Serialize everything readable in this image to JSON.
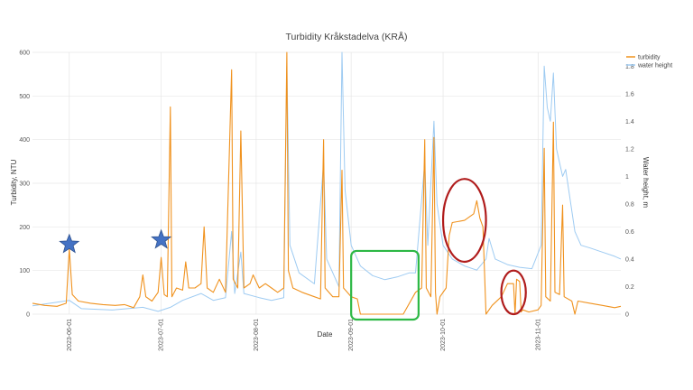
{
  "chart_data": {
    "type": "line",
    "title": "Turbidity Kråkstadelva (KRÅ)",
    "xlabel": "Date",
    "ylabel_left": "Turbidity, NTU",
    "ylabel_right": "Water height, m",
    "ylim_left": [
      0,
      600
    ],
    "ylim_right": [
      0,
      1.9
    ],
    "yticks_left": [
      "0",
      "100",
      "200",
      "300",
      "400",
      "500",
      "600"
    ],
    "yticks_right": [
      "0",
      "0.2",
      "0.4",
      "0.6",
      "0.8",
      "1",
      "1.2",
      "1.4",
      "1.6",
      "1.8"
    ],
    "x_range": [
      "2023-05-20",
      "2023-11-28"
    ],
    "xticks": [
      "2023-06-01",
      "2023-07-01",
      "2023-08-01",
      "2023-09-01",
      "2023-10-01",
      "2023-11-01"
    ],
    "grid": true,
    "legend_position": "top-right",
    "colors": {
      "turbidity": "#f0921e",
      "water_height": "#9ecbf2",
      "star": "#4472c4",
      "green_box": "#2db845",
      "red_ellipse": "#b01c1c"
    },
    "series": [
      {
        "name": "turbidity",
        "axis": "left",
        "points": [
          [
            "2023-05-20",
            25
          ],
          [
            "2023-05-24",
            20
          ],
          [
            "2023-05-28",
            18
          ],
          [
            "2023-05-31",
            25
          ],
          [
            "2023-06-01",
            150
          ],
          [
            "2023-06-02",
            45
          ],
          [
            "2023-06-04",
            30
          ],
          [
            "2023-06-08",
            25
          ],
          [
            "2023-06-12",
            22
          ],
          [
            "2023-06-16",
            20
          ],
          [
            "2023-06-19",
            22
          ],
          [
            "2023-06-22",
            15
          ],
          [
            "2023-06-24",
            40
          ],
          [
            "2023-06-25",
            90
          ],
          [
            "2023-06-26",
            40
          ],
          [
            "2023-06-28",
            30
          ],
          [
            "2023-06-30",
            50
          ],
          [
            "2023-07-01",
            130
          ],
          [
            "2023-07-02",
            45
          ],
          [
            "2023-07-03",
            40
          ],
          [
            "2023-07-04",
            475
          ],
          [
            "2023-07-04T12",
            40
          ],
          [
            "2023-07-06",
            60
          ],
          [
            "2023-07-08",
            55
          ],
          [
            "2023-07-09",
            120
          ],
          [
            "2023-07-10",
            60
          ],
          [
            "2023-07-12",
            60
          ],
          [
            "2023-07-14",
            70
          ],
          [
            "2023-07-15",
            200
          ],
          [
            "2023-07-16",
            60
          ],
          [
            "2023-07-18",
            50
          ],
          [
            "2023-07-20",
            80
          ],
          [
            "2023-07-22",
            50
          ],
          [
            "2023-07-24",
            560
          ],
          [
            "2023-07-24T12",
            80
          ],
          [
            "2023-07-26",
            60
          ],
          [
            "2023-07-27",
            420
          ],
          [
            "2023-07-28",
            60
          ],
          [
            "2023-07-30",
            70
          ],
          [
            "2023-07-31",
            90
          ],
          [
            "2023-08-02",
            60
          ],
          [
            "2023-08-04",
            70
          ],
          [
            "2023-08-06",
            60
          ],
          [
            "2023-08-08",
            50
          ],
          [
            "2023-08-10",
            60
          ],
          [
            "2023-08-11",
            600
          ],
          [
            "2023-08-11T12",
            100
          ],
          [
            "2023-08-13",
            60
          ],
          [
            "2023-08-16",
            50
          ],
          [
            "2023-08-20",
            40
          ],
          [
            "2023-08-22",
            35
          ],
          [
            "2023-08-23",
            400
          ],
          [
            "2023-08-23T12",
            60
          ],
          [
            "2023-08-26",
            40
          ],
          [
            "2023-08-28",
            40
          ],
          [
            "2023-08-29",
            330
          ],
          [
            "2023-08-29T12",
            60
          ],
          [
            "2023-09-01",
            40
          ],
          [
            "2023-09-03",
            35
          ],
          [
            "2023-09-04",
            0
          ],
          [
            "2023-09-18",
            0
          ],
          [
            "2023-09-22",
            50
          ],
          [
            "2023-09-24",
            60
          ],
          [
            "2023-09-25",
            400
          ],
          [
            "2023-09-25T12",
            60
          ],
          [
            "2023-09-27",
            40
          ],
          [
            "2023-09-28",
            405
          ],
          [
            "2023-09-28T12",
            50
          ],
          [
            "2023-09-29",
            0
          ],
          [
            "2023-09-30",
            40
          ],
          [
            "2023-10-02",
            60
          ],
          [
            "2023-10-03",
            180
          ],
          [
            "2023-10-04",
            210
          ],
          [
            "2023-10-08",
            215
          ],
          [
            "2023-10-11",
            230
          ],
          [
            "2023-10-12",
            260
          ],
          [
            "2023-10-13",
            220
          ],
          [
            "2023-10-14",
            200
          ],
          [
            "2023-10-15",
            0
          ],
          [
            "2023-10-17",
            20
          ],
          [
            "2023-10-20",
            40
          ],
          [
            "2023-10-22",
            70
          ],
          [
            "2023-10-24",
            70
          ],
          [
            "2023-10-24T12",
            0
          ],
          [
            "2023-10-25",
            80
          ],
          [
            "2023-10-26",
            75
          ],
          [
            "2023-10-26T12",
            5
          ],
          [
            "2023-10-27",
            10
          ],
          [
            "2023-10-29",
            5
          ],
          [
            "2023-11-01",
            10
          ],
          [
            "2023-11-02",
            20
          ],
          [
            "2023-11-03",
            380
          ],
          [
            "2023-11-03T12",
            40
          ],
          [
            "2023-11-05",
            30
          ],
          [
            "2023-11-06",
            440
          ],
          [
            "2023-11-06T12",
            50
          ],
          [
            "2023-11-08",
            45
          ],
          [
            "2023-11-09",
            250
          ],
          [
            "2023-11-09T12",
            40
          ],
          [
            "2023-11-12",
            30
          ],
          [
            "2023-11-13",
            0
          ],
          [
            "2023-11-14",
            30
          ],
          [
            "2023-11-18",
            25
          ],
          [
            "2023-11-22",
            20
          ],
          [
            "2023-11-26",
            15
          ],
          [
            "2023-11-28",
            18
          ]
        ]
      },
      {
        "name": "water height",
        "axis": "right",
        "points": [
          [
            "2023-05-20",
            0.06
          ],
          [
            "2023-06-01",
            0.1
          ],
          [
            "2023-06-05",
            0.04
          ],
          [
            "2023-06-15",
            0.03
          ],
          [
            "2023-06-25",
            0.05
          ],
          [
            "2023-06-30",
            0.02
          ],
          [
            "2023-07-04",
            0.05
          ],
          [
            "2023-07-08",
            0.1
          ],
          [
            "2023-07-14",
            0.15
          ],
          [
            "2023-07-18",
            0.1
          ],
          [
            "2023-07-22",
            0.12
          ],
          [
            "2023-07-24",
            0.6
          ],
          [
            "2023-07-25",
            0.15
          ],
          [
            "2023-07-27",
            0.45
          ],
          [
            "2023-07-28",
            0.15
          ],
          [
            "2023-08-02",
            0.12
          ],
          [
            "2023-08-06",
            0.1
          ],
          [
            "2023-08-10",
            0.12
          ],
          [
            "2023-08-11",
            1.8
          ],
          [
            "2023-08-12",
            0.5
          ],
          [
            "2023-08-15",
            0.3
          ],
          [
            "2023-08-20",
            0.22
          ],
          [
            "2023-08-23",
            1.1
          ],
          [
            "2023-08-24",
            0.4
          ],
          [
            "2023-08-26",
            0.3
          ],
          [
            "2023-08-28",
            0.2
          ],
          [
            "2023-08-29",
            1.9
          ],
          [
            "2023-08-30",
            0.9
          ],
          [
            "2023-09-01",
            0.5
          ],
          [
            "2023-09-04",
            0.35
          ],
          [
            "2023-09-08",
            0.28
          ],
          [
            "2023-09-12",
            0.25
          ],
          [
            "2023-09-16",
            0.27
          ],
          [
            "2023-09-20",
            0.3
          ],
          [
            "2023-09-22",
            0.3
          ],
          [
            "2023-09-25",
            1.1
          ],
          [
            "2023-09-26",
            0.5
          ],
          [
            "2023-09-28",
            1.4
          ],
          [
            "2023-09-29",
            0.8
          ],
          [
            "2023-10-01",
            0.5
          ],
          [
            "2023-10-04",
            0.4
          ],
          [
            "2023-10-08",
            0.35
          ],
          [
            "2023-10-12",
            0.32
          ],
          [
            "2023-10-15",
            0.4
          ],
          [
            "2023-10-16",
            0.55
          ],
          [
            "2023-10-18",
            0.4
          ],
          [
            "2023-10-22",
            0.36
          ],
          [
            "2023-10-26",
            0.34
          ],
          [
            "2023-10-30",
            0.33
          ],
          [
            "2023-11-02",
            0.5
          ],
          [
            "2023-11-03",
            1.8
          ],
          [
            "2023-11-04",
            1.5
          ],
          [
            "2023-11-05",
            1.4
          ],
          [
            "2023-11-06",
            1.75
          ],
          [
            "2023-11-07",
            1.2
          ],
          [
            "2023-11-09",
            1.0
          ],
          [
            "2023-11-10",
            1.05
          ],
          [
            "2023-11-13",
            0.6
          ],
          [
            "2023-11-15",
            0.5
          ],
          [
            "2023-11-18",
            0.48
          ],
          [
            "2023-11-22",
            0.45
          ],
          [
            "2023-11-26",
            0.42
          ],
          [
            "2023-11-28",
            0.4
          ]
        ]
      }
    ],
    "annotations": [
      {
        "type": "star",
        "x": "2023-06-01",
        "y": 160
      },
      {
        "type": "star",
        "x": "2023-07-01",
        "y": 170
      },
      {
        "type": "green-box",
        "x": [
          "2023-09-01",
          "2023-09-23"
        ],
        "y": [
          0,
          145
        ]
      },
      {
        "type": "red-ellipse",
        "x": [
          "2023-10-01",
          "2023-10-15"
        ],
        "y": [
          120,
          310
        ]
      },
      {
        "type": "red-ellipse",
        "x": [
          "2023-10-20",
          "2023-10-28"
        ],
        "y": [
          0,
          100
        ]
      }
    ]
  }
}
